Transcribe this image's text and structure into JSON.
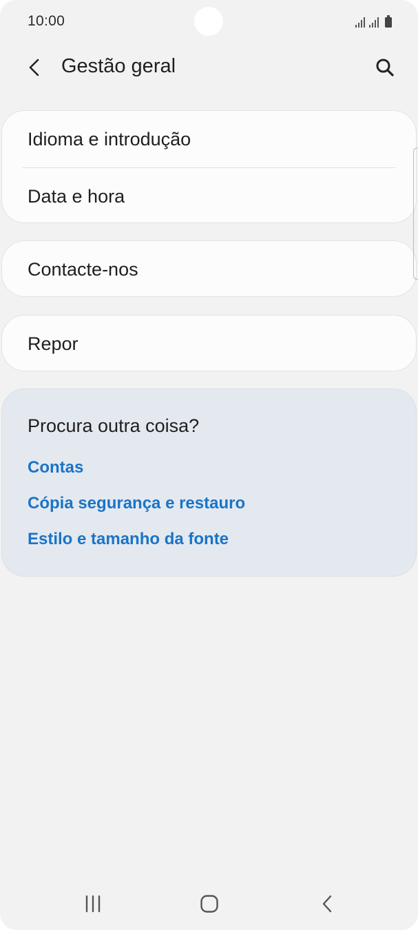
{
  "status_bar": {
    "time": "10:00"
  },
  "header": {
    "title": "Gestão geral",
    "back_icon": "chevron-left-icon",
    "search_icon": "search-icon"
  },
  "menu": {
    "group1": [
      {
        "label": "Idioma e introdução"
      },
      {
        "label": "Data e hora"
      }
    ],
    "group2": [
      {
        "label": "Contacte-nos"
      }
    ],
    "group3": [
      {
        "label": "Repor"
      }
    ]
  },
  "suggestions": {
    "title": "Procura outra coisa?",
    "links": [
      {
        "label": "Contas"
      },
      {
        "label": "Cópia segurança e restauro"
      },
      {
        "label": "Estilo e tamanho da fonte"
      }
    ],
    "link_color": "#1a74c7"
  },
  "nav_bar": {
    "recents_icon": "recents-icon",
    "home_icon": "home-icon",
    "back_icon": "back-icon"
  }
}
